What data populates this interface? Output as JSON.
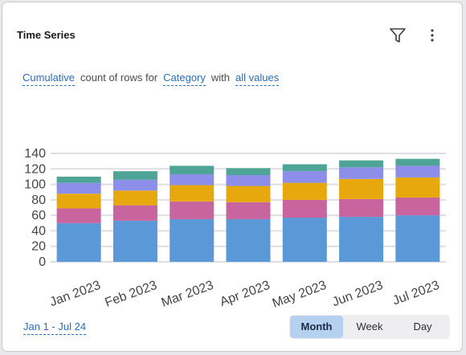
{
  "widget": {
    "title": "Time Series",
    "filter_icon": "filter-funnel-icon",
    "more_icon": "vertical-ellipsis-icon"
  },
  "query": {
    "mode": "Cumulative",
    "text1": "count of rows for",
    "field": "Category",
    "text2": "with",
    "values": "all values"
  },
  "date_range": "Jan 1 - Jul 24",
  "granularity": {
    "options": [
      "Month",
      "Week",
      "Day"
    ],
    "selected": "Month"
  },
  "colors": {
    "accent": "#2b6cc4",
    "selected_bg": "#b6d0f0"
  },
  "chart_data": {
    "type": "bar",
    "stacked": true,
    "categories": [
      "Jan 2023",
      "Feb 2023",
      "Mar 2023",
      "Apr 2023",
      "May 2023",
      "Jun 2023",
      "Jul 2023"
    ],
    "series": [
      {
        "color": "#5b98d8",
        "values": [
          50,
          53,
          55,
          55,
          57,
          58,
          60
        ]
      },
      {
        "color": "#c8659f",
        "values": [
          19,
          20,
          23,
          22,
          23,
          23,
          23
        ]
      },
      {
        "color": "#e6a80c",
        "values": [
          19,
          19,
          21,
          21,
          22,
          26,
          26
        ]
      },
      {
        "color": "#8c8eea",
        "values": [
          14,
          14,
          14,
          14,
          15,
          15,
          15
        ]
      },
      {
        "color": "#4ea596",
        "values": [
          8,
          11,
          11,
          9,
          9,
          9,
          9
        ]
      }
    ],
    "yticks": [
      0,
      20,
      40,
      60,
      80,
      100,
      120,
      140
    ],
    "ylim": [
      0,
      140
    ],
    "grid": true,
    "xlabel": "",
    "ylabel": ""
  }
}
